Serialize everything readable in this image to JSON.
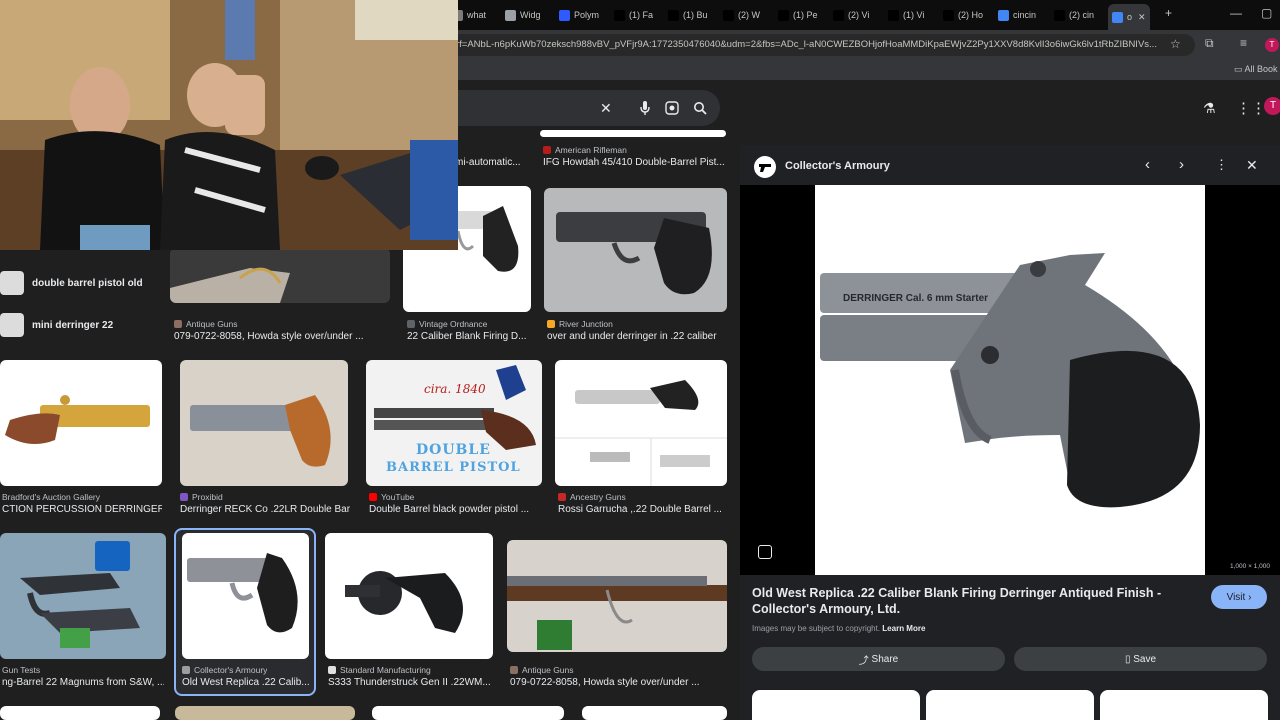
{
  "browser": {
    "tabs": [
      {
        "label": "what",
        "color": "#7b7b7b"
      },
      {
        "label": "Widg",
        "color": "#9aa0a6"
      },
      {
        "label": "Polym",
        "color": "#2e5bff"
      },
      {
        "label": "(1) Fa",
        "color": "#000000"
      },
      {
        "label": "(1) Bu",
        "color": "#000000"
      },
      {
        "label": "(2) W",
        "color": "#000000"
      },
      {
        "label": "(1) Pe",
        "color": "#000000"
      },
      {
        "label": "(2) Vi",
        "color": "#000000"
      },
      {
        "label": "(1) Vi",
        "color": "#000000"
      },
      {
        "label": "(2) Ho",
        "color": "#000000"
      },
      {
        "label": "cincin",
        "color": "#4285f4"
      },
      {
        "label": "(2) cin",
        "color": "#000000"
      },
      {
        "label": "o",
        "color": "#4285f4"
      }
    ],
    "url": "rf=ANbL-n6pKuWb70zeksch988vBV_pVFjr9A:1772350476040&udm=2&fbs=ADc_l-aN0CWEZBOHjofHoaMMDiKpaEWjvZ2Py1XXV8d8KvlI3o6iwGk6lv1tRbZIBNIVs...",
    "bookmarks_label": "All Book"
  },
  "related_searches": [
    {
      "label": "double barrel pistol old"
    },
    {
      "label": "mini derringer 22"
    }
  ],
  "results_row0": [
    {
      "source": "",
      "title": "mi-automatic..."
    },
    {
      "source": "American Rifleman",
      "title": "IFG Howdah 45/410 Double-Barrel Pist..."
    }
  ],
  "results_row1": [
    {
      "source": "Antique Guns",
      "title": "079-0722-8058, Howda style over/under ..."
    },
    {
      "source": "Vintage Ordnance",
      "title": "22 Caliber Blank Firing D..."
    },
    {
      "source": "River Junction",
      "title": "over and under derringer in .22 caliber"
    }
  ],
  "results_row2": [
    {
      "source": "Bradford's Auction Gallery",
      "title": "CTION PERCUSSION DERRINGER P..."
    },
    {
      "source": "Proxibid",
      "title": "Derringer RECK Co .22LR Double Bar..."
    },
    {
      "source": "YouTube",
      "title": "Double Barrel black powder pistol ..."
    },
    {
      "source": "Ancestry Guns",
      "title": "Rossi Garrucha ,.22 Double Barrel ..."
    }
  ],
  "results_row3": [
    {
      "source": "Gun Tests",
      "title": "ng-Barrel 22 Magnums from S&W, ..."
    },
    {
      "source": "Collector's Armoury",
      "title": "Old West Replica .22 Calib..."
    },
    {
      "source": "Standard Manufacturing",
      "title": "S333 Thunderstruck Gen II .22WM..."
    },
    {
      "source": "Antique Guns",
      "title": "079-0722-8058, Howda style over/under ..."
    }
  ],
  "tile_text": {
    "cira": "cira. 1840",
    "double": "DOUBLE",
    "barrel_pistol": "BARREL PISTOL",
    "stamp": "DERRINGER Cal. 6 mm Starter"
  },
  "panel": {
    "site": "Collector's Armoury",
    "dimensions": "1,000 × 1,000",
    "title": "Old West Replica .22 Caliber Blank Firing Derringer Antiqued Finish - Collector's Armoury, Ltd.",
    "copyright": "Images may be subject to copyright.",
    "learn_more": "Learn More",
    "visit": "Visit",
    "share": "Share",
    "save": "Save"
  },
  "colors": {
    "accent": "#8ab4f8",
    "profile": "#c2185b",
    "selected_border": "#8ab4f8"
  }
}
